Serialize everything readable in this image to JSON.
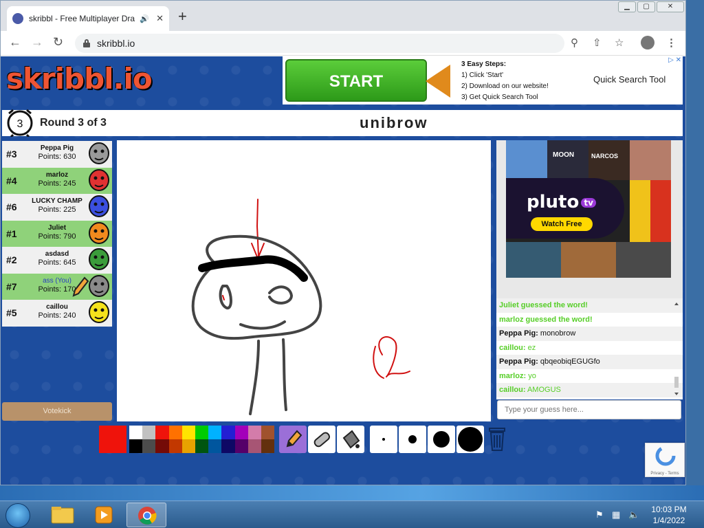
{
  "browser": {
    "tab_title": "skribbl - Free Multiplayer Dra",
    "url": "skribbl.io",
    "new_tab": "+",
    "tab_close": "✕",
    "audio": "🔊"
  },
  "window_controls": {
    "minimize": "▁",
    "maximize": "▢",
    "close": "✕"
  },
  "logo": {
    "text": "skribbl.io"
  },
  "ad_top": {
    "button": "START",
    "steps_heading": "3 Easy Steps:",
    "step1": "1) Click 'Start'",
    "step2": "2) Download on our website!",
    "step3": "3) Get Quick Search Tool",
    "brand": "Quick Search Tool",
    "close": "▷ ✕"
  },
  "game": {
    "round_number": "3",
    "round_label": "Round 3 of 3",
    "word": "unibrow"
  },
  "players": [
    {
      "rank": "#3",
      "name": "Peppa Pig",
      "points": "Points: 630",
      "you": false,
      "drawing": false,
      "color": "#9a9a9a"
    },
    {
      "rank": "#4",
      "name": "marloz",
      "points": "Points: 245",
      "you": false,
      "drawing": false,
      "color": "#e03232"
    },
    {
      "rank": "#6",
      "name": "LUCKY CHAMP",
      "points": "Points: 225",
      "you": false,
      "drawing": false,
      "color": "#3b4fe0"
    },
    {
      "rank": "#1",
      "name": "Juliet",
      "points": "Points: 790",
      "you": false,
      "drawing": false,
      "color": "#f18a1e"
    },
    {
      "rank": "#2",
      "name": "asdasd",
      "points": "Points: 645",
      "you": false,
      "drawing": false,
      "color": "#3b9c3b"
    },
    {
      "rank": "#7",
      "name": "ass (You)",
      "points": "Points: 170",
      "you": true,
      "drawing": true,
      "color": "#8a8a8a"
    },
    {
      "rank": "#5",
      "name": "caillou",
      "points": "Points: 240",
      "you": false,
      "drawing": false,
      "color": "#f5e21c"
    }
  ],
  "votekick": "Votekick",
  "ad_right": {
    "logo": "pluto",
    "logo_badge": "tv",
    "cta": "Watch Free",
    "poster1": "MOON",
    "poster2": "NARCOS"
  },
  "chat": [
    {
      "who": "",
      "text": "Juliet guessed the word!",
      "kind": "system"
    },
    {
      "who": "",
      "text": "marloz guessed the word!",
      "kind": "system"
    },
    {
      "who": "Peppa Pig:",
      "text": "monobrow",
      "kind": "guess"
    },
    {
      "who": "caillou:",
      "text": "ez",
      "kind": "chat"
    },
    {
      "who": "Peppa Pig:",
      "text": "qbqeobiqEGUGfo",
      "kind": "guess"
    },
    {
      "who": "marloz:",
      "text": "yo",
      "kind": "chat"
    },
    {
      "who": "caillou:",
      "text": "AMOGUS",
      "kind": "chat"
    }
  ],
  "guess_placeholder": "Type your guess here...",
  "palette": {
    "current": "#ef130b",
    "top": [
      "#ffffff",
      "#c1c1c1",
      "#ef130b",
      "#ff7100",
      "#ffe400",
      "#00cc00",
      "#00b2ff",
      "#231fd3",
      "#a300ba",
      "#d37caa",
      "#a0522d"
    ],
    "bottom": [
      "#000000",
      "#4c4c4c",
      "#740b07",
      "#c23800",
      "#e8a200",
      "#005510",
      "#00569e",
      "#0e0865",
      "#550069",
      "#a75574",
      "#63300d"
    ]
  },
  "recaptcha": "Privacy - Terms",
  "taskbar": {
    "time": "10:03 PM",
    "date": "1/4/2022"
  }
}
